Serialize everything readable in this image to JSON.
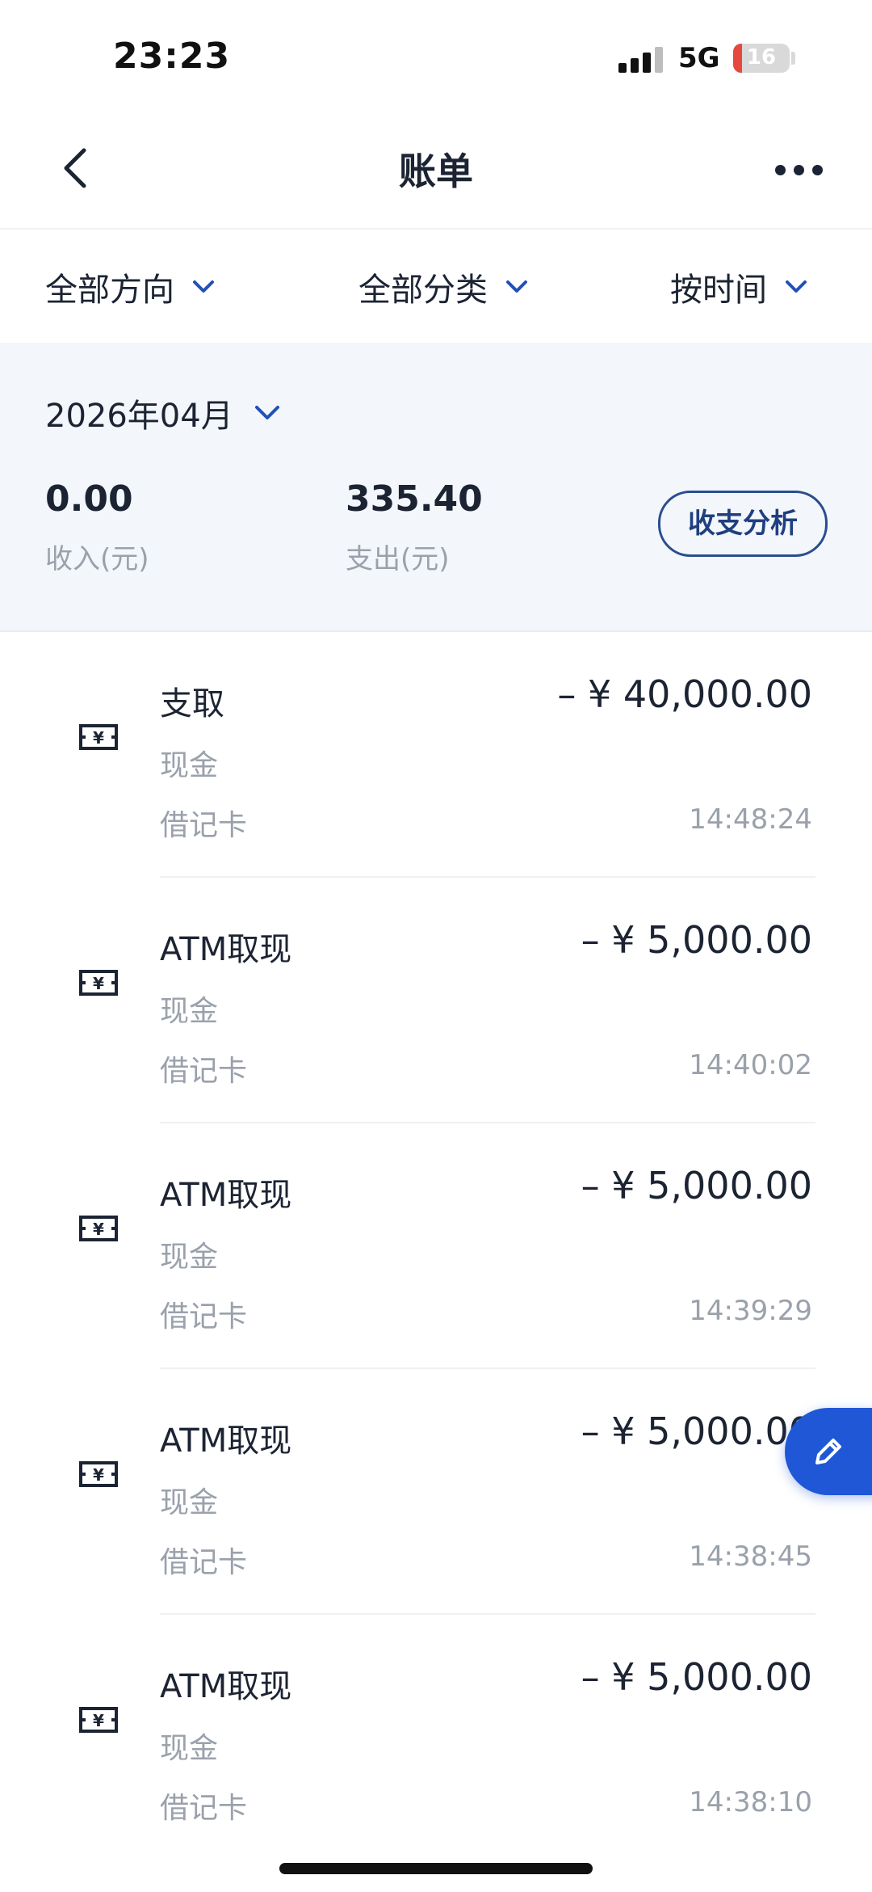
{
  "status_bar": {
    "time": "23:23",
    "network": "5G",
    "battery": "16",
    "battery_level": 0.16
  },
  "nav": {
    "title": "账单"
  },
  "filters": [
    {
      "label": "全部方向"
    },
    {
      "label": "全部分类"
    },
    {
      "label": "按时间"
    }
  ],
  "summary": {
    "month": "2026年04月",
    "income_value": "0.00",
    "income_label": "收入(元)",
    "expense_value": "335.40",
    "expense_label": "支出(元)",
    "analysis_button": "收支分析"
  },
  "transactions": [
    {
      "title": "支取",
      "amount": "– ¥ 40,000.00",
      "category": "现金",
      "card": "借记卡",
      "time": "14:48:24"
    },
    {
      "title": "ATM取现",
      "amount": "– ¥ 5,000.00",
      "category": "现金",
      "card": "借记卡",
      "time": "14:40:02"
    },
    {
      "title": "ATM取现",
      "amount": "– ¥ 5,000.00",
      "category": "现金",
      "card": "借记卡",
      "time": "14:39:29"
    },
    {
      "title": "ATM取现",
      "amount": "– ¥ 5,000.00",
      "category": "现金",
      "card": "借记卡",
      "time": "14:38:45"
    },
    {
      "title": "ATM取现",
      "amount": "– ¥ 5,000.00",
      "category": "现金",
      "card": "借记卡",
      "time": "14:38:10"
    }
  ],
  "colors": {
    "accent": "#1f57d6",
    "brand_dark": "#1f3f80",
    "text": "#1c2433",
    "muted": "#9aa1ab",
    "panel_bg": "#f3f6fa",
    "battery_low": "#e5483f"
  },
  "icons": {
    "back": "chevron-left-icon",
    "more": "more-dots-icon",
    "dropdown": "chevron-down-icon",
    "cash": "cash-icon",
    "edit": "pencil-icon"
  }
}
